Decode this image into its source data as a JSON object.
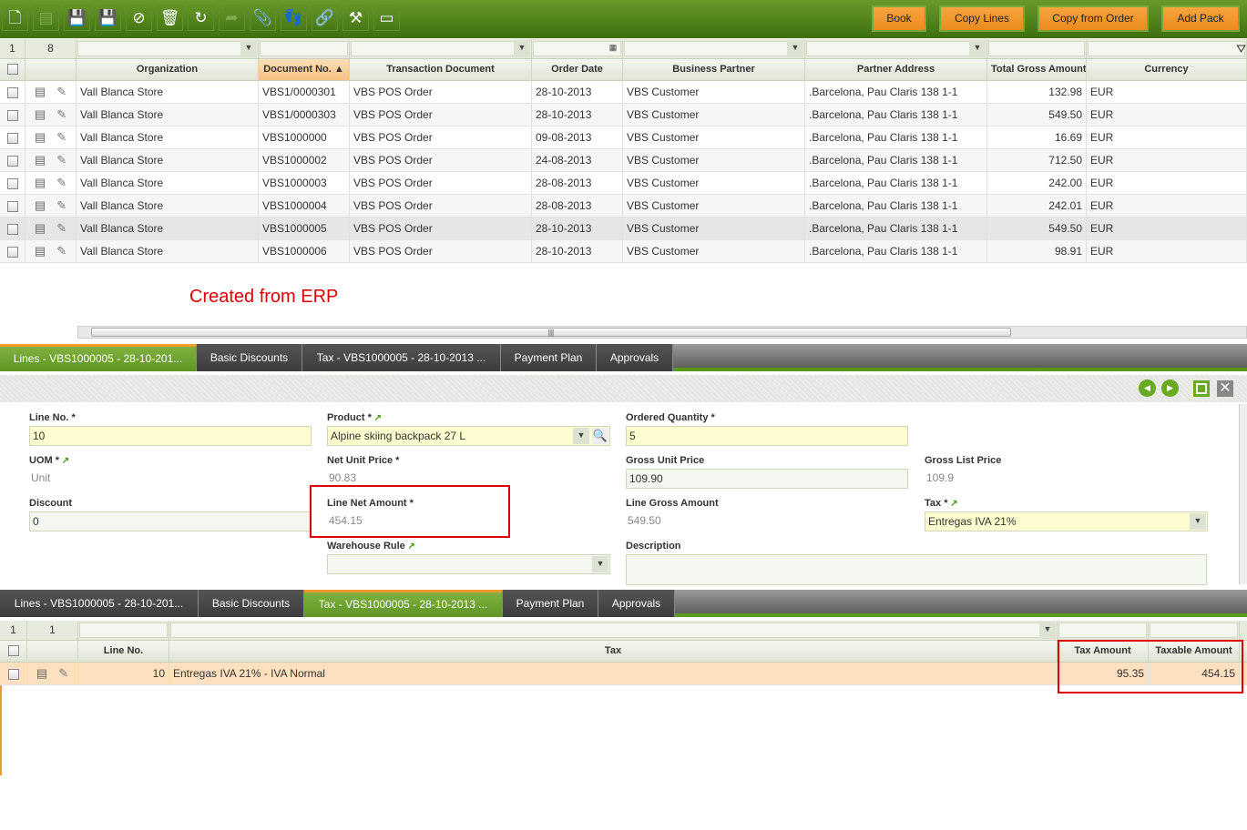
{
  "toolbar": {
    "icons": [
      "new-document-icon",
      "grid-view-icon",
      "save-icon",
      "save-close-icon",
      "undo-icon",
      "delete-icon",
      "refresh-icon",
      "export-icon",
      "attachment-icon",
      "audit-trail-icon",
      "link-icon",
      "tools-icon",
      "form-toggle-icon"
    ],
    "buttons": [
      "Book",
      "Copy Lines",
      "Copy from Order",
      "Add Pack"
    ]
  },
  "header_grid": {
    "selected_count": "1",
    "total_count": "8",
    "columns": [
      "Organization",
      "Document No.",
      "Transaction Document",
      "Order Date",
      "Business Partner",
      "Partner Address",
      "Total Gross Amount",
      "Currency"
    ],
    "sorted_column": "Document No.",
    "sort_dir": "asc",
    "rows": [
      [
        "Vall Blanca Store",
        "VBS1/0000301",
        "VBS POS Order",
        "28-10-2013",
        "VBS Customer",
        ".Barcelona, Pau Claris 138 1-1",
        "132.98",
        "EUR"
      ],
      [
        "Vall Blanca Store",
        "VBS1/0000303",
        "VBS POS Order",
        "28-10-2013",
        "VBS Customer",
        ".Barcelona, Pau Claris 138 1-1",
        "549.50",
        "EUR"
      ],
      [
        "Vall Blanca Store",
        "VBS1000000",
        "VBS POS Order",
        "09-08-2013",
        "VBS Customer",
        ".Barcelona, Pau Claris 138 1-1",
        "16.69",
        "EUR"
      ],
      [
        "Vall Blanca Store",
        "VBS1000002",
        "VBS POS Order",
        "24-08-2013",
        "VBS Customer",
        ".Barcelona, Pau Claris 138 1-1",
        "712.50",
        "EUR"
      ],
      [
        "Vall Blanca Store",
        "VBS1000003",
        "VBS POS Order",
        "28-08-2013",
        "VBS Customer",
        ".Barcelona, Pau Claris 138 1-1",
        "242.00",
        "EUR"
      ],
      [
        "Vall Blanca Store",
        "VBS1000004",
        "VBS POS Order",
        "28-08-2013",
        "VBS Customer",
        ".Barcelona, Pau Claris 138 1-1",
        "242.01",
        "EUR"
      ],
      [
        "Vall Blanca Store",
        "VBS1000005",
        "VBS POS Order",
        "28-10-2013",
        "VBS Customer",
        ".Barcelona, Pau Claris 138 1-1",
        "549.50",
        "EUR"
      ],
      [
        "Vall Blanca Store",
        "VBS1000006",
        "VBS POS Order",
        "28-10-2013",
        "VBS Customer",
        ".Barcelona, Pau Claris 138 1-1",
        "98.91",
        "EUR"
      ]
    ],
    "selected_row": 6
  },
  "annotation": "Created from ERP",
  "tabs1": [
    "Lines - VBS1000005 - 28-10-201...",
    "Basic Discounts",
    "Tax - VBS1000005 - 28-10-2013 ...",
    "Payment Plan",
    "Approvals"
  ],
  "tabs2": [
    "Lines - VBS1000005 - 28-10-201...",
    "Basic Discounts",
    "Tax - VBS1000005 - 28-10-2013 ...",
    "Payment Plan",
    "Approvals"
  ],
  "form": {
    "line_no": {
      "label": "Line No. *",
      "value": "10"
    },
    "product": {
      "label": "Product *",
      "value": "Alpine skiing backpack 27 L"
    },
    "ordered_qty": {
      "label": "Ordered Quantity *",
      "value": "5"
    },
    "uom": {
      "label": "UOM *",
      "value": "Unit"
    },
    "net_unit_price": {
      "label": "Net Unit Price *",
      "value": "90.83"
    },
    "gross_unit_price": {
      "label": "Gross Unit Price",
      "value": "109.90"
    },
    "gross_list_price": {
      "label": "Gross List Price",
      "value": "109.9"
    },
    "discount": {
      "label": "Discount",
      "value": "0"
    },
    "line_net_amount": {
      "label": "Line Net Amount *",
      "value": "454.15"
    },
    "line_gross_amount": {
      "label": "Line Gross Amount",
      "value": "549.50"
    },
    "tax": {
      "label": "Tax *",
      "value": "Entregas IVA 21%"
    },
    "warehouse_rule": {
      "label": "Warehouse Rule",
      "value": ""
    },
    "description": {
      "label": "Description",
      "value": ""
    }
  },
  "tax_grid": {
    "selected_count": "1",
    "total_count": "1",
    "columns": [
      "Line No.",
      "Tax",
      "Tax Amount",
      "Taxable Amount"
    ],
    "rows": [
      [
        "10",
        "Entregas IVA 21% - IVA Normal",
        "95.35",
        "454.15"
      ]
    ]
  },
  "colors": {
    "accent": "#5f9623",
    "button": "#ef921f",
    "highlight": "#e00000",
    "selected_row": "#fde0c0"
  }
}
